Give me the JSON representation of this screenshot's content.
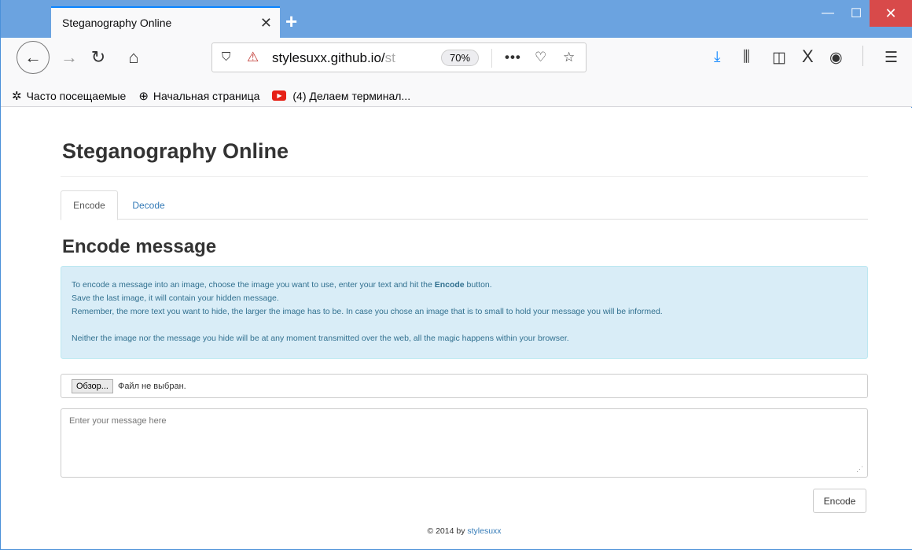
{
  "browser": {
    "tab_title": "Steganography Online",
    "tab_close": "✕",
    "new_tab": "+",
    "window_minimize": "—",
    "window_maximize": "☐",
    "window_close": "✕",
    "url_host": "stylesuxx.github.io/",
    "url_path_partial": "st",
    "zoom": "70%",
    "bookmarks": [
      {
        "label": "Часто посещаемые",
        "icon": "gear-icon"
      },
      {
        "label": "Начальная страница",
        "icon": "globe-icon"
      },
      {
        "label": "(4) Делаем терминал...",
        "icon": "youtube-icon"
      }
    ]
  },
  "page": {
    "title": "Steganography Online",
    "tabs": [
      {
        "label": "Encode",
        "active": true
      },
      {
        "label": "Decode",
        "active": false
      }
    ],
    "section_title": "Encode message",
    "info": {
      "line1_pre": "To encode a message into an image, choose the image you want to use, enter your text and hit the ",
      "line1_bold": "Encode",
      "line1_post": " button.",
      "line2": "Save the last image, it will contain your hidden message.",
      "line3": "Remember, the more text you want to hide, the larger the image has to be. In case you chose an image that is to small to hold your message you will be informed.",
      "line4": "Neither the image nor the message you hide will be at any moment transmitted over the web, all the magic happens within your browser."
    },
    "file_input": {
      "browse_label": "Обзор...",
      "status": "Файл не выбран."
    },
    "message_placeholder": "Enter your message here",
    "encode_button": "Encode",
    "footer_prefix": "© 2014 by ",
    "footer_link": "stylesuxx"
  },
  "colors": {
    "titlebar": "#6ba3e0",
    "link": "#337ab7",
    "info_bg": "#d9edf7",
    "info_text": "#31708f"
  }
}
